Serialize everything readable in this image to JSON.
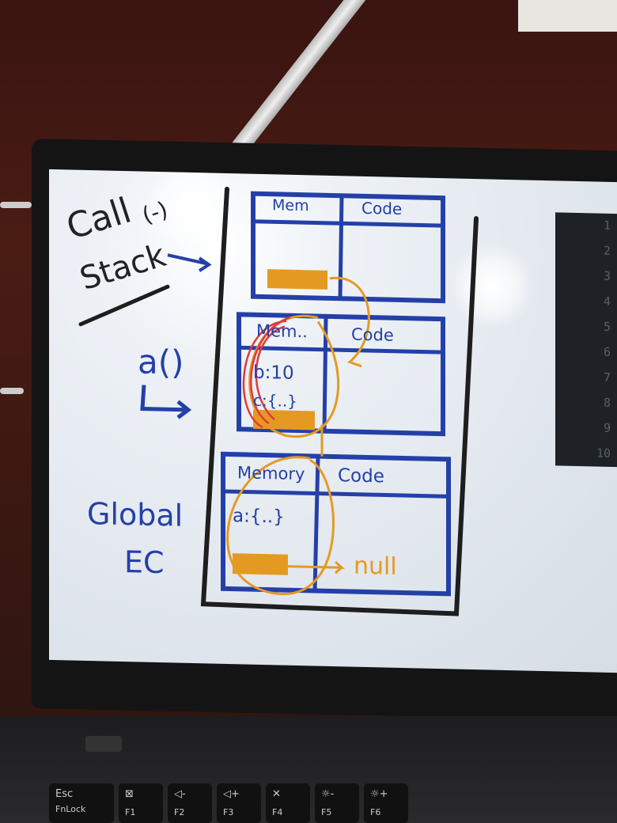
{
  "whiteboard": {
    "call_stack_label_1": "Call",
    "call_stack_label_2": "Stack",
    "call_stack_paren": "(-)",
    "func_a_label": "a()",
    "global_label_1": "Global",
    "global_label_2": "EC",
    "ec_top": {
      "memory": "Mem",
      "code": "Code"
    },
    "ec_middle": {
      "memory": "Mem..",
      "code": "Code",
      "entries": [
        "b:10",
        "c:{..}"
      ]
    },
    "ec_global": {
      "memory": "Memory",
      "code": "Code",
      "entries": [
        "a:{..}"
      ]
    },
    "null_label": "null",
    "colors": {
      "ink_blue": "#2440a8",
      "ink_black": "#1e1e1e",
      "highlight_orange": "#e49a22",
      "loop_red": "#e23a3a"
    }
  },
  "line_numbers": [
    "1",
    "2",
    "3",
    "4",
    "5",
    "6",
    "7",
    "8",
    "9",
    "10"
  ],
  "keyboard": {
    "keys": [
      {
        "main": "Esc",
        "sub": "FnLock"
      },
      {
        "main": "⊠",
        "sub": "F1"
      },
      {
        "main": "◁-",
        "sub": "F2"
      },
      {
        "main": "◁+",
        "sub": "F3"
      },
      {
        "main": "✕",
        "sub": "F4"
      },
      {
        "main": "☼-",
        "sub": "F5"
      },
      {
        "main": "☼+",
        "sub": "F6"
      }
    ]
  }
}
